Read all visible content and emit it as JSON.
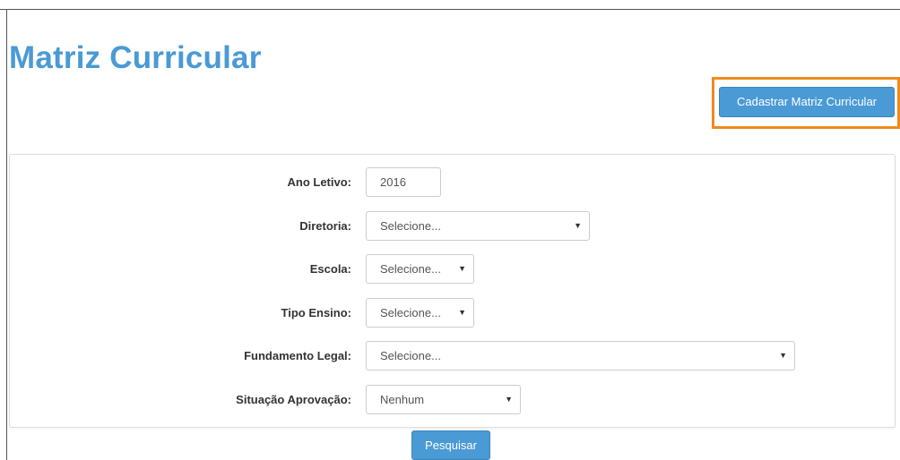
{
  "page": {
    "title": "Matriz Curricular",
    "register_button_label": "Cadastrar Matriz Curricular",
    "search_button_label": "Pesquisar"
  },
  "form": {
    "ano_letivo": {
      "label": "Ano Letivo:",
      "value": "2016"
    },
    "diretoria": {
      "label": "Diretoria:",
      "value": "Selecione..."
    },
    "escola": {
      "label": "Escola:",
      "value": "Selecione..."
    },
    "tipo_ensino": {
      "label": "Tipo Ensino:",
      "value": "Selecione..."
    },
    "fundamento_legal": {
      "label": "Fundamento Legal:",
      "value": "Selecione..."
    },
    "situacao_aprovacao": {
      "label": "Situação Aprovação:",
      "value": "Nenhum"
    }
  },
  "icons": {
    "select_caret": "caret-down-icon"
  },
  "colors": {
    "accent": "#4a9ad5",
    "highlight": "#f08a1c"
  }
}
